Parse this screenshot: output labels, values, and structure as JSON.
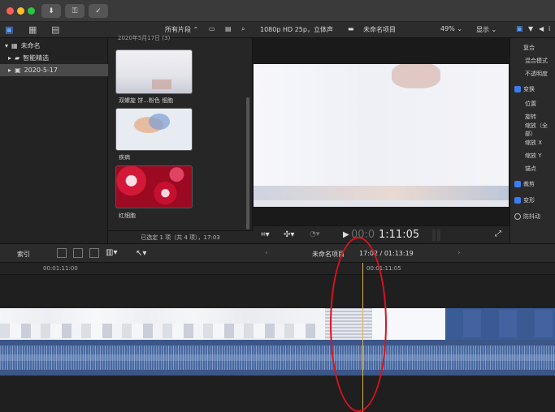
{
  "titlebar": {
    "colors": {
      "close": "#ff5f57",
      "minimize": "#febc2e",
      "zoom": "#28c840"
    },
    "buttons": [
      {
        "name": "download-icon",
        "glyph": "⬇"
      },
      {
        "name": "key-icon",
        "glyph": "⚿"
      },
      {
        "name": "check-circle-icon",
        "glyph": "✓"
      }
    ]
  },
  "toolbar": {
    "browser_filter": "所有片段 ⌃",
    "viewer_format": "1080p HD 25p，立体声",
    "viewer_project": "未命名项目",
    "viewer_zoom": "49% ⌄",
    "viewer_display": "显示 ⌄"
  },
  "library": {
    "items": [
      {
        "label": "未命名",
        "selected": false
      },
      {
        "label": "智能精选",
        "selected": false
      },
      {
        "label": "2020-5-17",
        "selected": true
      }
    ]
  },
  "browser": {
    "section_title": "2020年5月17日 (3)",
    "clips": [
      {
        "label": "双螺旋 饼...粉色 细胞"
      },
      {
        "label": "疾病"
      },
      {
        "label": "红细胞"
      }
    ],
    "status": "已选定 1 项（共 4 项），17:03"
  },
  "viewer": {
    "timecode_dim": "00:0",
    "timecode_bright": "1:11:05"
  },
  "inspector": {
    "rows": [
      {
        "label": "复合",
        "checkbox": false
      },
      {
        "label": "混合模式",
        "checkbox": false
      },
      {
        "label": "不透明度",
        "checkbox": false
      },
      {
        "label": "变换",
        "checkbox": true
      },
      {
        "label": "位置",
        "checkbox": false
      },
      {
        "label": "旋转",
        "checkbox": false
      },
      {
        "label": "缩放（全部）",
        "checkbox": false
      },
      {
        "label": "缩放 X",
        "checkbox": false
      },
      {
        "label": "缩放 Y",
        "checkbox": false
      },
      {
        "label": "锚点",
        "checkbox": false
      },
      {
        "label": "裁剪",
        "checkbox": true
      },
      {
        "label": "变形",
        "checkbox": true
      },
      {
        "label": "防抖动",
        "checkbox": false
      }
    ]
  },
  "timeline": {
    "index_label": "索引",
    "project_label": "未命名项目",
    "duration_label": "17:02 / 01:13:19",
    "ruler_left": "00:01:11:00",
    "ruler_right": "00:01:11:05"
  }
}
